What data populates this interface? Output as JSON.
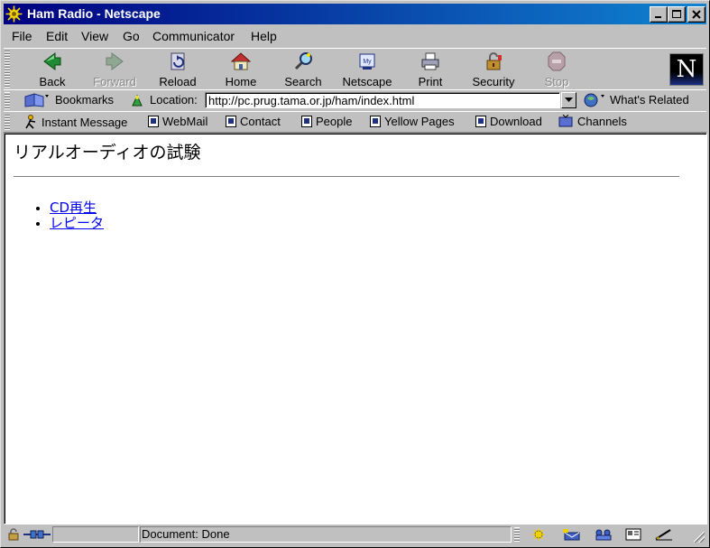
{
  "window": {
    "title": "Ham Radio - Netscape"
  },
  "menu": [
    "File",
    "Edit",
    "View",
    "Go",
    "Communicator",
    "Help"
  ],
  "toolbar": {
    "buttons": [
      {
        "label": "Back",
        "icon": "back-arrow-icon",
        "enabled": true
      },
      {
        "label": "Forward",
        "icon": "forward-arrow-icon",
        "enabled": false
      },
      {
        "label": "Reload",
        "icon": "reload-icon",
        "enabled": true
      },
      {
        "label": "Home",
        "icon": "home-icon",
        "enabled": true
      },
      {
        "label": "Search",
        "icon": "search-icon",
        "enabled": true
      },
      {
        "label": "Netscape",
        "icon": "my-netscape-icon",
        "enabled": true
      },
      {
        "label": "Print",
        "icon": "printer-icon",
        "enabled": true
      },
      {
        "label": "Security",
        "icon": "padlock-icon",
        "enabled": true
      },
      {
        "label": "Stop",
        "icon": "stop-icon",
        "enabled": false
      }
    ],
    "logo": "N"
  },
  "location_bar": {
    "bookmarks_label": "Bookmarks",
    "location_label": "Location:",
    "url": "http://pc.prug.tama.or.jp/ham/index.html",
    "whats_related_label": "What's Related"
  },
  "personal_toolbar": [
    "Instant Message",
    "WebMail",
    "Contact",
    "People",
    "Yellow Pages",
    "Download",
    "Channels"
  ],
  "page": {
    "heading": "リアルオーディオの試験",
    "links": [
      "CD再生",
      "レピータ"
    ]
  },
  "status": {
    "text": "Document: Done"
  },
  "colors": {
    "titlebar": "#000080",
    "link": "#0000ee",
    "chrome": "#c0c0c0"
  }
}
